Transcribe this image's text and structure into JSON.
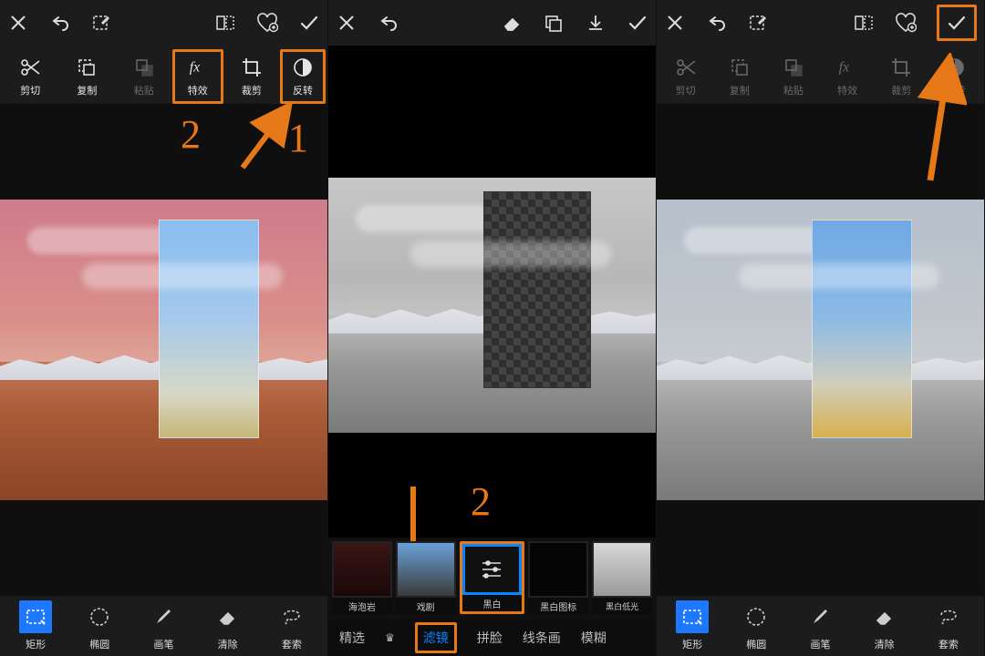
{
  "topIcons": {
    "close": "close",
    "undo": "undo",
    "edit": "edit",
    "mirror": "mirror",
    "heart": "heart",
    "check": "check",
    "eraser": "eraser",
    "overlay": "overlay",
    "download": "download"
  },
  "edit": {
    "cut": "剪切",
    "copy": "复制",
    "paste": "粘贴",
    "fx": "特效",
    "crop": "裁剪",
    "invert": "反转"
  },
  "shape": {
    "rect": "矩形",
    "ellipse": "椭圆",
    "brush": "画笔",
    "erase": "清除",
    "lasso": "套索"
  },
  "filters": {
    "f1": "海泡岩",
    "f2": "戏剧",
    "f3": "黑白",
    "f4": "黑白图标",
    "f5": "黑白低光"
  },
  "cats": {
    "feat": "精选",
    "filter": "滤镜",
    "face": "拼脸",
    "line": "线条画",
    "blur": "模糊"
  },
  "anno": {
    "one": "1",
    "twoA": "2",
    "twoB": "2"
  }
}
